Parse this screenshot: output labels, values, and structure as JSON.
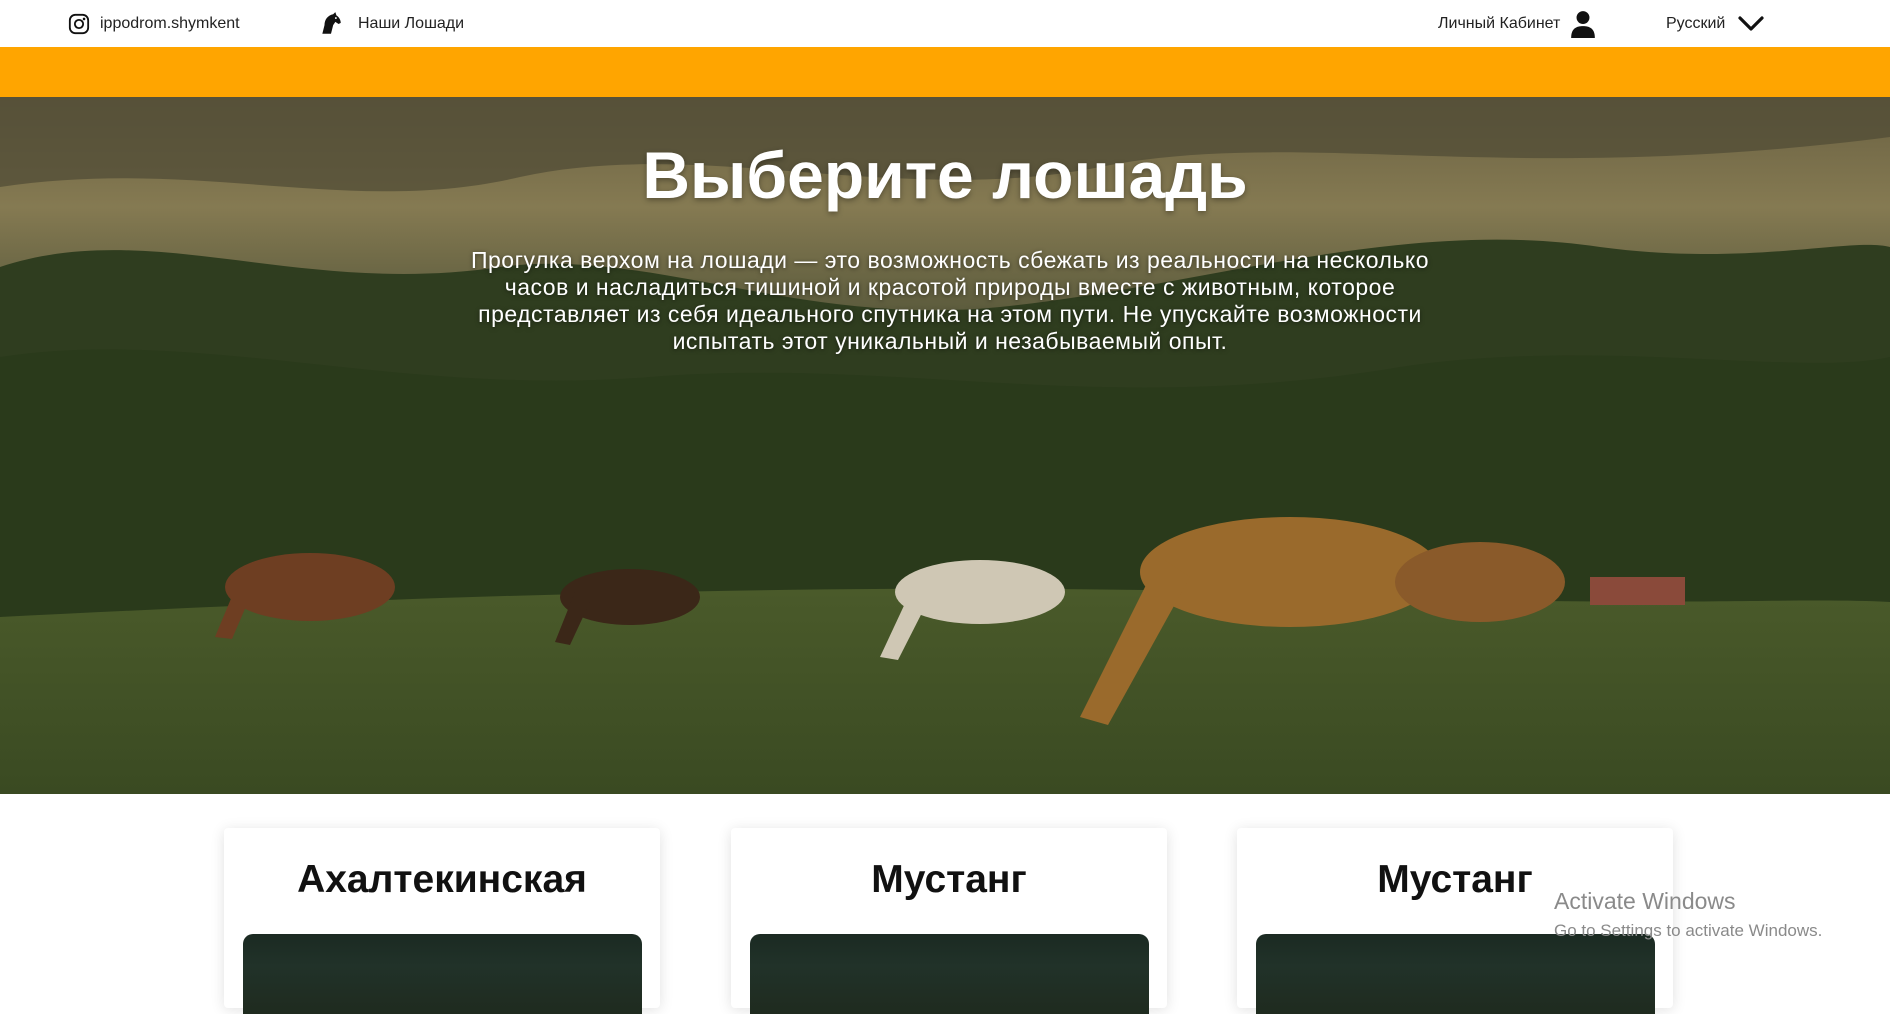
{
  "nav": {
    "instagram_label": "ippodrom.shymkent",
    "horses_label": "Наши Лошади",
    "cabinet_label": "Личный Кабинет",
    "language_label": "Русский"
  },
  "hero": {
    "title": "Выберите лошадь",
    "text": "Прогулка верхом на лошади — это возможность сбежать из реальности на несколько часов и насладиться тишиной и красотой природы вместе с животным, которое представляет из себя идеального спутника на этом пути. Не упускайте возможности испытать этот уникальный и незабываемый опыт."
  },
  "cards": [
    {
      "title": "Ахалтекинская"
    },
    {
      "title": "Мустанг"
    },
    {
      "title": "Мустанг"
    }
  ],
  "watermark": {
    "line1": "Activate Windows",
    "line2": "Go to Settings to activate Windows."
  },
  "colors": {
    "accent_bar": "#ffa500",
    "nav_bg": "#ffffff",
    "hero_text": "#ffffff"
  },
  "icons": {
    "instagram": "instagram-icon",
    "horse": "horse-head-icon",
    "user": "user-icon",
    "chevron": "chevron-down-icon"
  }
}
